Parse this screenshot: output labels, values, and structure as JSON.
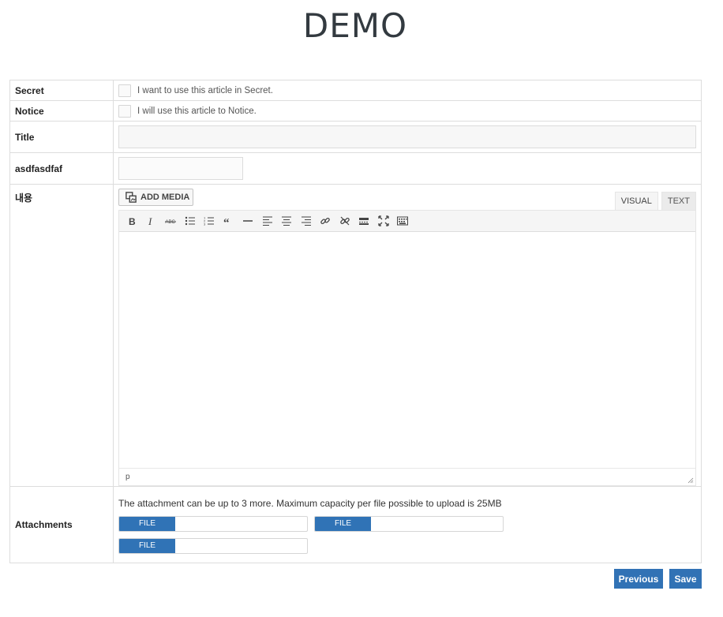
{
  "page": {
    "title": "DEMO"
  },
  "rows": {
    "secret": {
      "label": "Secret",
      "checkbox_text": "I want to use this article in Secret."
    },
    "notice": {
      "label": "Notice",
      "checkbox_text": "I will use this article to Notice."
    },
    "title": {
      "label": "Title",
      "value": ""
    },
    "custom": {
      "label": "asdfasdfaf",
      "value": ""
    },
    "content": {
      "label": "내용"
    },
    "attachments": {
      "label": "Attachments",
      "note": "The attachment can be up to 3 more. Maximum capacity per file possible to upload is 25MB",
      "file_button": "FILE"
    }
  },
  "editor": {
    "add_media": "ADD MEDIA",
    "tabs": [
      "VISUAL",
      "TEXT"
    ],
    "active_tab": "VISUAL",
    "toolbar_icons": [
      "bold-icon",
      "italic-icon",
      "strikethrough-icon",
      "bullet-list-icon",
      "numbered-list-icon",
      "blockquote-icon",
      "horizontal-line-icon",
      "align-left-icon",
      "align-center-icon",
      "align-right-icon",
      "link-icon",
      "unlink-icon",
      "read-more-icon",
      "fullscreen-icon",
      "toolbar-toggle-icon"
    ],
    "status_path": "p"
  },
  "actions": {
    "previous": "Previous",
    "save": "Save"
  },
  "colors": {
    "primary": "#3172b5",
    "border": "#dddddd"
  }
}
